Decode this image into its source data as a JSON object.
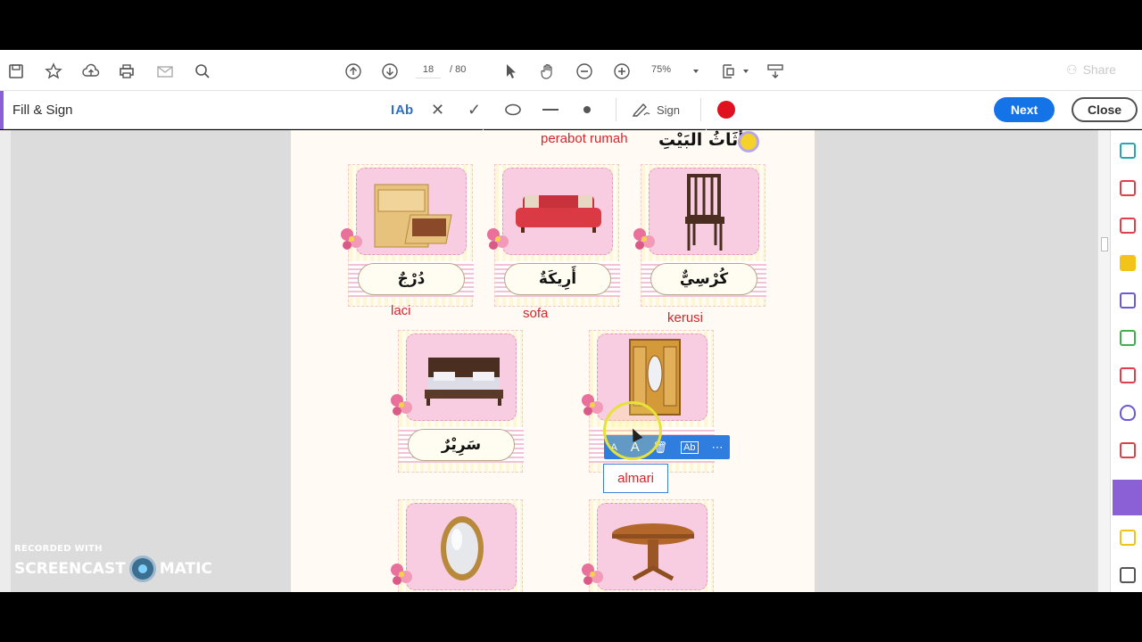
{
  "toolbar": {
    "page_current": "18",
    "page_total": "/ 80",
    "zoom": "75%",
    "share_label": "Share"
  },
  "fill_sign": {
    "title": "Fill & Sign",
    "text_tool_label": "Ab",
    "sign_label": "Sign",
    "next_label": "Next",
    "close_label": "Close"
  },
  "document": {
    "title_latin": "perabot rumah",
    "title_arabic": "أَثَاثُ البَيْتِ",
    "items": [
      {
        "arabic": "دُرْجٌ",
        "malay": "laci",
        "icon": "drawer-cabinet-icon"
      },
      {
        "arabic": "أَرِيكَةٌ",
        "malay": "sofa",
        "icon": "sofa-icon"
      },
      {
        "arabic": "كُرْسِيٌّ",
        "malay": "kerusi",
        "icon": "chair-icon"
      },
      {
        "arabic": "سَرِيْرٌ",
        "malay": "",
        "icon": "bed-icon"
      },
      {
        "arabic": "",
        "malay": "",
        "icon": "wardrobe-icon"
      },
      {
        "arabic": "",
        "malay": "",
        "icon": "mirror-icon"
      },
      {
        "arabic": "",
        "malay": "",
        "icon": "table-icon"
      }
    ],
    "active_text_field": "almari"
  },
  "watermark": {
    "recorded_with": "RECORDED WITH",
    "brand_left": "SCREENCAST",
    "brand_right": "MATIC"
  },
  "colors": {
    "accent_blue": "#1473e6",
    "annotation_red": "#d8252c",
    "fill_sign_purple": "#8b5fd6"
  }
}
